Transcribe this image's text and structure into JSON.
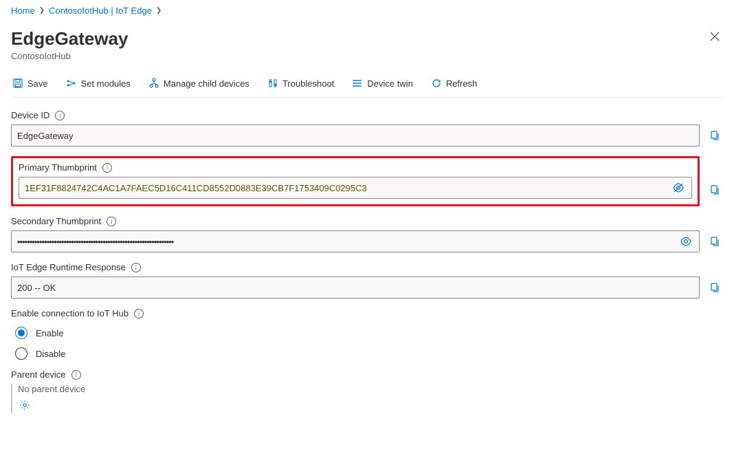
{
  "breadcrumb": {
    "items": [
      "Home",
      "ContosoIotHub | IoT Edge"
    ]
  },
  "header": {
    "title": "EdgeGateway",
    "subtitle": "ContosoIotHub"
  },
  "toolbar": {
    "save": "Save",
    "set_modules": "Set modules",
    "manage_child": "Manage child devices",
    "troubleshoot": "Troubleshoot",
    "device_twin": "Device twin",
    "refresh": "Refresh"
  },
  "fields": {
    "device_id_label": "Device ID",
    "device_id_value": "EdgeGateway",
    "primary_thumb_label": "Primary Thumbprint",
    "primary_thumb_value": "1EF31F8824742C4AC1A7FAEC5D16C411CD8552D0883E39CB7F1753409C0295C3",
    "secondary_thumb_label": "Secondary Thumbprint",
    "secondary_thumb_masked": "••••••••••••••••••••••••••••••••••••••••••••••••••••••••••••••••",
    "runtime_label": "IoT Edge Runtime Response",
    "runtime_value": "200 -- OK",
    "enable_conn_label": "Enable connection to IoT Hub",
    "enable_option": "Enable",
    "disable_option": "Disable",
    "parent_label": "Parent device",
    "parent_none": "No parent device"
  }
}
